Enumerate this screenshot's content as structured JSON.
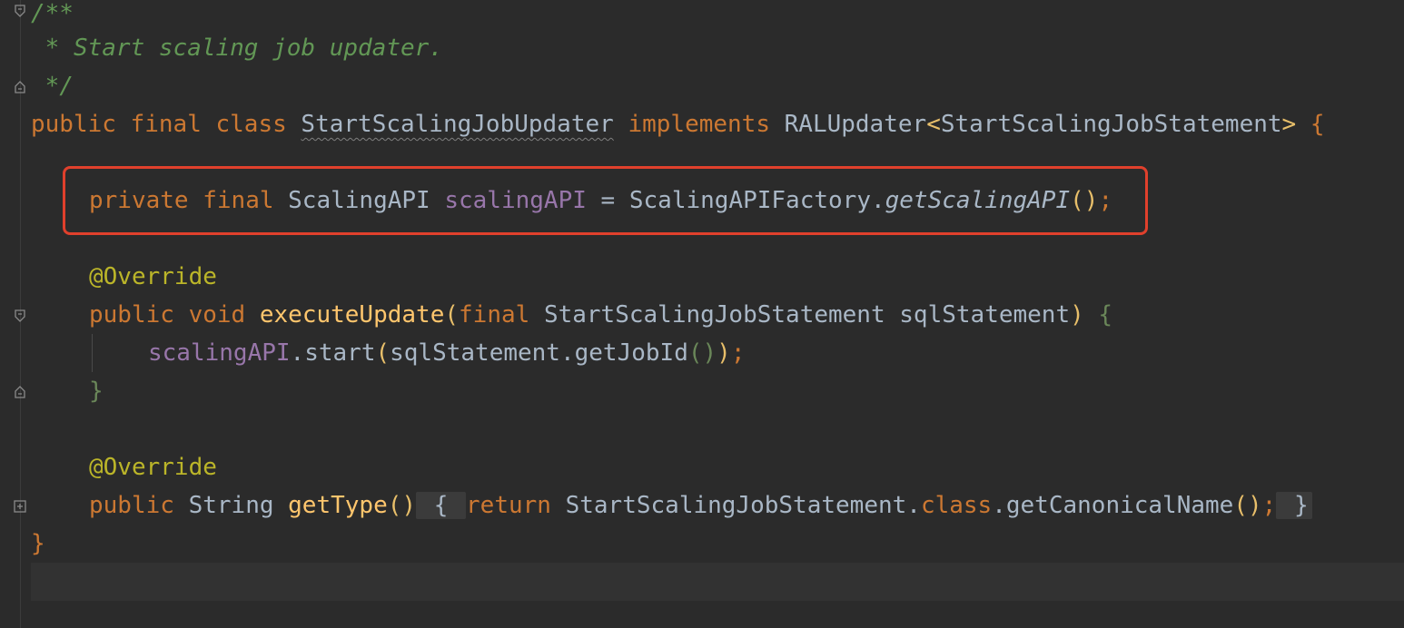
{
  "code": {
    "line1": "/**",
    "line2": " * Start scaling job updater.",
    "line3": " */",
    "line4": {
      "public": "public ",
      "final": "final ",
      "class": "class ",
      "classname": "StartScalingJobUpdater",
      "implements": " implements ",
      "iface": "RALUpdater",
      "lt": "<",
      "generic": "StartScalingJobStatement",
      "gt": ">",
      "brace": " {"
    },
    "line6": {
      "private": "private ",
      "final": "final ",
      "type": "ScalingAPI ",
      "field": "scalingAPI",
      "eq": " = ",
      "factory": "ScalingAPIFactory.",
      "method": "getScalingAPI",
      "parens": "()",
      "semi": ";"
    },
    "line8": "@Override",
    "line9": {
      "public": "public ",
      "void": "void ",
      "method": "executeUpdate",
      "open": "(",
      "final": "final ",
      "type": "StartScalingJobStatement sqlStatement",
      "close": ")",
      "brace": " {"
    },
    "line10": {
      "field": "scalingAPI",
      "call": ".start",
      "open": "(",
      "arg": "sqlStatement.getJobId",
      "inner": "()",
      "close": ")",
      "semi": ";"
    },
    "line11": "}",
    "line13": "@Override",
    "line14": {
      "public": "public ",
      "type": "String ",
      "method": "getType",
      "parens": "()",
      "open": " { ",
      "ret": "return ",
      "stmt": "StartScalingJobStatement.",
      "cls": "class",
      "call": ".getCanonicalName",
      "callparens": "()",
      "semi": ";",
      "close": " }"
    },
    "line15": "}"
  },
  "colors": {
    "background": "#2b2b2b",
    "keyword": "#cc7832",
    "comment": "#629755",
    "annotation": "#bbb529",
    "field": "#9876aa",
    "method": "#ffc66d",
    "highlight_border": "#e0402c"
  },
  "icons": [
    "fold-open-icon",
    "fold-close-icon",
    "fold-expand-icon"
  ]
}
